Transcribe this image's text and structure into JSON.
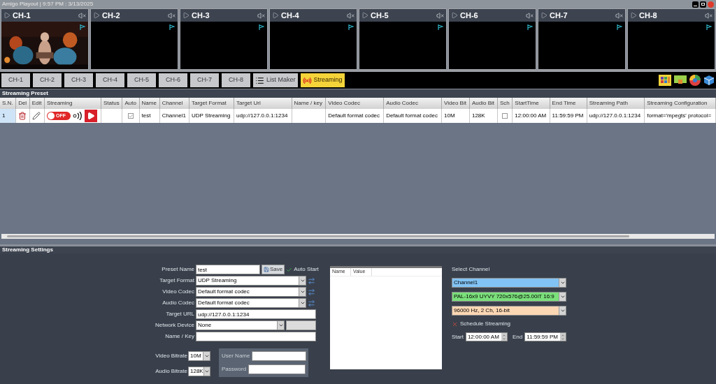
{
  "window": {
    "title": "Amigo Playout | 9:57 PM : 3/13/2025"
  },
  "monitors": [
    {
      "label": "CH-1",
      "has_video": true
    },
    {
      "label": "CH-2",
      "has_video": false
    },
    {
      "label": "CH-3",
      "has_video": false
    },
    {
      "label": "CH-4",
      "has_video": false
    },
    {
      "label": "CH-5",
      "has_video": false
    },
    {
      "label": "CH-6",
      "has_video": false
    },
    {
      "label": "CH-7",
      "has_video": false
    },
    {
      "label": "CH-8",
      "has_video": false
    }
  ],
  "tabs": [
    {
      "label": "CH-1",
      "kind": "channel",
      "selected": false
    },
    {
      "label": "CH-2",
      "kind": "channel",
      "selected": false
    },
    {
      "label": "CH-3",
      "kind": "channel",
      "selected": false
    },
    {
      "label": "CH-4",
      "kind": "channel",
      "selected": false
    },
    {
      "label": "CH-5",
      "kind": "channel",
      "selected": false
    },
    {
      "label": "CH-6",
      "kind": "channel",
      "selected": false
    },
    {
      "label": "CH-7",
      "kind": "channel",
      "selected": false
    },
    {
      "label": "CH-8",
      "kind": "channel",
      "selected": false
    },
    {
      "label": "List Maker",
      "kind": "list",
      "selected": false
    },
    {
      "label": "Streaming",
      "kind": "streaming",
      "selected": true
    }
  ],
  "preset": {
    "title": "Streaming Preset",
    "columns": [
      "S.N.",
      "Del",
      "Edit",
      "Streaming",
      "Status",
      "Auto",
      "Name",
      "Channel",
      "Target Format",
      "Target Url",
      "Name / key",
      "Video Codec",
      "Audio Codec",
      "Video Bit",
      "Audio Bit",
      "Sch",
      "StartTime",
      "End Time",
      "Streaming Path",
      "Streaming Configuration"
    ],
    "rows": [
      {
        "sn": "1",
        "streaming_on": false,
        "toggle_label": "OFF",
        "auto": true,
        "name": "test",
        "channel": "Channel1",
        "target_format": "UDP Streaming",
        "target_url": "udp://127.0.0.1:1234",
        "video_codec": "Default format codec",
        "audio_codec": "Default format codec",
        "video_bit": "10M",
        "audio_bit": "128K",
        "sch": false,
        "start_time": "12:00:00 AM",
        "end_time": "11:59:59 PM",
        "streaming_path": "udp://127.0.0.1:1234",
        "configuration": "format='mpegts' protocol="
      }
    ]
  },
  "settings": {
    "title": "Streaming Settings",
    "preset_name": {
      "label": "Preset Name",
      "value": "test"
    },
    "save": "Save",
    "auto_start": {
      "label": "Auto Start",
      "checked": true
    },
    "target_format": {
      "label": "Target Format",
      "value": "UDP Streaming"
    },
    "video_codec": {
      "label": "Video Codec",
      "value": "Default format codec"
    },
    "audio_codec": {
      "label": "Audio Codec",
      "value": "Default format codec"
    },
    "target_url": {
      "label": "Target URL",
      "value": "udp://127.0.0.1:1234"
    },
    "network_device": {
      "label": "Network Device",
      "value": "None"
    },
    "name_key": {
      "label": "Name / Key"
    },
    "video_bitrate": {
      "label": "Video Bitrate",
      "value": "10M"
    },
    "audio_bitrate": {
      "label": "Audio Bitrate",
      "value": "128K"
    },
    "user_name": {
      "label": "User Name"
    },
    "password": {
      "label": "Password"
    },
    "properties": {
      "columns": [
        "Name",
        "Value"
      ]
    },
    "select_channel": {
      "label": "Select Channel",
      "channel": "Channel1",
      "video_format": "PAL-16x9 UYVY 720x576@25.00iT 16:9",
      "audio_format": "96000 Hz, 2 Ch, 16-bit"
    },
    "schedule": {
      "label": "Schedule Streaming",
      "checked": false,
      "start_label": "Start",
      "start": "12:00:00 AM",
      "end_label": "End",
      "end": "11:59:59 PM"
    }
  }
}
